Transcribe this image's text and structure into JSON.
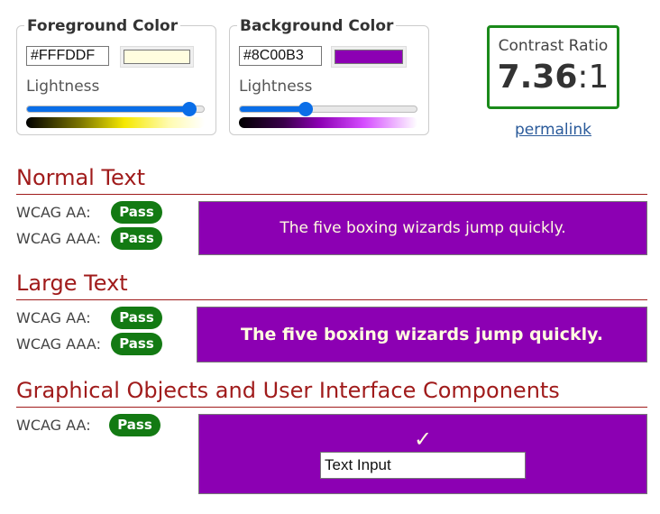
{
  "foreground": {
    "legend": "Foreground Color",
    "hex": "#FFFDDF",
    "swatch_color": "#FFFDDF",
    "lightness_label": "Lightness",
    "lightness_value": 0.92
  },
  "background": {
    "legend": "Background Color",
    "hex": "#8C00B3",
    "swatch_color": "#8C00B3",
    "lightness_label": "Lightness",
    "lightness_value": 0.37
  },
  "contrast": {
    "label": "Contrast Ratio",
    "ratio": "7.36",
    "suffix": ":1",
    "permalink": "permalink"
  },
  "sections": {
    "normal": {
      "title": "Normal Text",
      "aa_label": "WCAG AA:",
      "aa_result": "Pass",
      "aaa_label": "WCAG AAA:",
      "aaa_result": "Pass",
      "sample": "The five boxing wizards jump quickly."
    },
    "large": {
      "title": "Large Text",
      "aa_label": "WCAG AA:",
      "aa_result": "Pass",
      "aaa_label": "WCAG AAA:",
      "aaa_result": "Pass",
      "sample": "The five boxing wizards jump quickly."
    },
    "graphical": {
      "title": "Graphical Objects and User Interface Components",
      "aa_label": "WCAG AA:",
      "aa_result": "Pass",
      "checkmark": "✓",
      "input_text": "Text Input"
    }
  },
  "colors": {
    "heading": "#A01B1B",
    "pass": "#137A13",
    "slider": "#0A6EE8",
    "contrast_border": "#1A8A1A"
  }
}
